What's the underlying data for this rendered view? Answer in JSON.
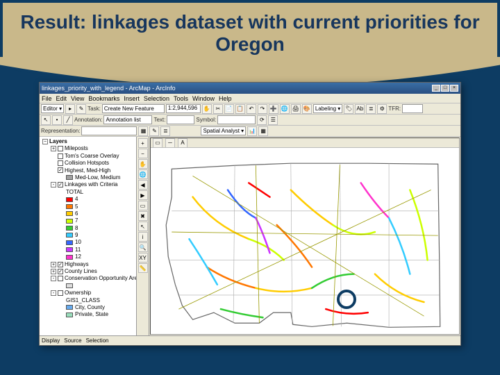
{
  "slide": {
    "title": "Result: linkages dataset with current priorities for Oregon"
  },
  "window": {
    "title": "linkages_priority_with_legend - ArcMap - ArcInfo",
    "buttons": {
      "min": "_",
      "max": "□",
      "close": "×"
    }
  },
  "menu": [
    "File",
    "Edit",
    "View",
    "Bookmarks",
    "Insert",
    "Selection",
    "Tools",
    "Window",
    "Help"
  ],
  "toolbar1": {
    "editor_label": "Editor ▾",
    "task_label": "Task:",
    "task_value": "Create New Feature",
    "scale": "1:2,944,596",
    "labeling": "Labeling ▾",
    "tfr_label": "TFR:"
  },
  "toolbar2": {
    "annotation_label": "Annotation:",
    "annotation_value": "Annotation list",
    "text_label": "Text:",
    "symbol_label": "Symbol:"
  },
  "toolbar3": {
    "representation_label": "Representation:",
    "representation_value": "",
    "spatial_label": "Spatial Analyst ▾"
  },
  "toc": {
    "tabs": [
      "Display",
      "Source",
      "Selection"
    ],
    "root": "Layers",
    "layers": [
      {
        "name": "Mileposts",
        "checked": false,
        "expander": "+",
        "children": []
      },
      {
        "name": "Tom's Coarse Overlay",
        "checked": false,
        "expander": "",
        "children": []
      },
      {
        "name": "Collision Hotspots",
        "checked": false,
        "expander": "",
        "children": []
      },
      {
        "name": "Highest, Med-High",
        "checked": true,
        "expander": "",
        "children": [
          {
            "label": "Med-Low, Medium",
            "swatch": "#a0a0a0"
          }
        ]
      },
      {
        "name": "Linkages with Criteria",
        "checked": true,
        "expander": "-",
        "children": [
          {
            "label": "TOTAL",
            "swatch": ""
          },
          {
            "label": "4",
            "swatch": "#ff0000"
          },
          {
            "label": "5",
            "swatch": "#ff7700"
          },
          {
            "label": "6",
            "swatch": "#ffcc00"
          },
          {
            "label": "7",
            "swatch": "#ccff00"
          },
          {
            "label": "8",
            "swatch": "#33cc33"
          },
          {
            "label": "9",
            "swatch": "#33ccff"
          },
          {
            "label": "10",
            "swatch": "#3366ff"
          },
          {
            "label": "11",
            "swatch": "#cc33ff"
          },
          {
            "label": "12",
            "swatch": "#ff33cc"
          }
        ]
      },
      {
        "name": "Highways",
        "checked": true,
        "expander": "+",
        "children": []
      },
      {
        "name": "County Lines",
        "checked": true,
        "expander": "+",
        "children": []
      },
      {
        "name": "Conservation Opportunity Areas",
        "checked": false,
        "expander": "-",
        "children": [
          {
            "label": "",
            "swatch": "#dddddd"
          }
        ]
      },
      {
        "name": "Ownership",
        "checked": false,
        "expander": "-",
        "children": [
          {
            "label": "GIS1_CLASS",
            "swatch": ""
          },
          {
            "label": "City, County",
            "swatch": "#66aaee"
          },
          {
            "label": "Private, State",
            "swatch": "#99ddbb"
          }
        ]
      }
    ]
  },
  "icons": {
    "pan": "✋",
    "zoomin": "+",
    "zoomout": "−",
    "full": "🌐",
    "prev": "◀",
    "next": "▶",
    "info": "i",
    "find": "🔍",
    "measure": "📏",
    "select": "▭",
    "xy": "XY",
    "arrow": "↖",
    "clear": "✖"
  },
  "map": {
    "state": "Oregon",
    "colors": {
      "county_line": "#808080",
      "road": "#999900"
    }
  }
}
